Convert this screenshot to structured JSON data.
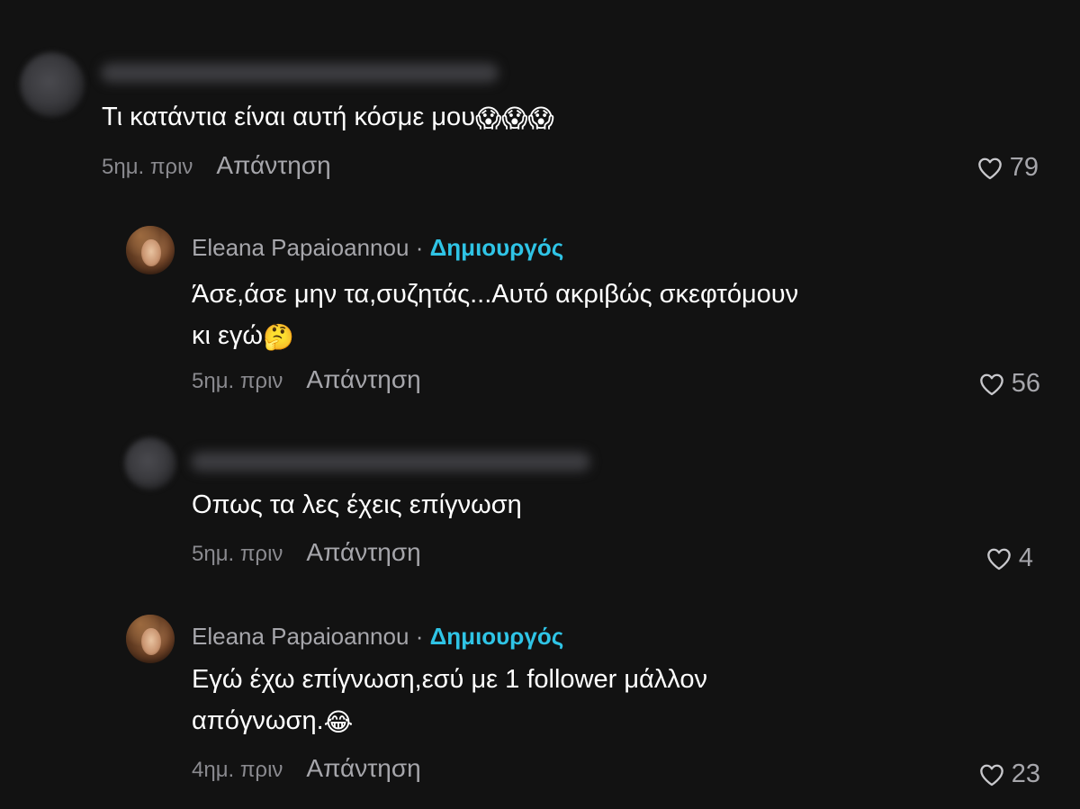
{
  "comments": [
    {
      "text_line1": "Τι κατάντια είναι αυτή κόσμε μου",
      "emoji": "😱😱😱",
      "time": "5ημ. πριν",
      "reply": "Απάντηση",
      "likes": "79"
    },
    {
      "username": "Eleana Papaioannou",
      "separator": "·",
      "badge": "Δημιουργός",
      "text_line1": "Άσε,άσε μην τα,συζητάς...Αυτό ακριβώς σκεφτόμουν",
      "text_line2": "κι εγώ",
      "emoji": "🤔",
      "time": "5ημ. πριν",
      "reply": "Απάντηση",
      "likes": "56"
    },
    {
      "text_line1": "Οπως τα λες έχεις επίγνωση",
      "time": "5ημ. πριν",
      "reply": "Απάντηση",
      "likes": "4"
    },
    {
      "username": "Eleana Papaioannou",
      "separator": "·",
      "badge": "Δημιουργός",
      "text_line1": "Εγώ έχω επίγνωση,εσύ με 1 follower μάλλον",
      "text_line2": "απόγνωση.",
      "emoji": "😂",
      "time": "4ημ. πριν",
      "reply": "Απάντηση",
      "likes": "23"
    }
  ],
  "colors": {
    "background": "#121212",
    "creator_badge": "#2fc4e6",
    "secondary_text": "#a6a6ab"
  },
  "icons": {
    "like": "heart-outline-icon"
  }
}
